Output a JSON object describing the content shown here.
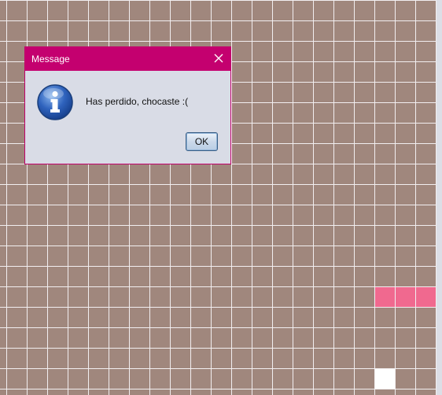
{
  "game": {
    "board_color": "#a0877d",
    "grid_line_color": "#f2eef0",
    "snake_color": "#f0698f",
    "food_color": "#ffffff",
    "snake_cells": [
      {
        "col": 18,
        "row": 14
      },
      {
        "col": 19,
        "row": 14
      },
      {
        "col": 20,
        "row": 14
      }
    ],
    "food_cells": [
      {
        "col": 18,
        "row": 18
      }
    ]
  },
  "dialog": {
    "title": "Message",
    "close_icon": "close-icon",
    "icon": "info-icon",
    "message": "Has perdido, chocaste :(",
    "ok_label": "OK",
    "titlebar_color": "#c4006f"
  }
}
